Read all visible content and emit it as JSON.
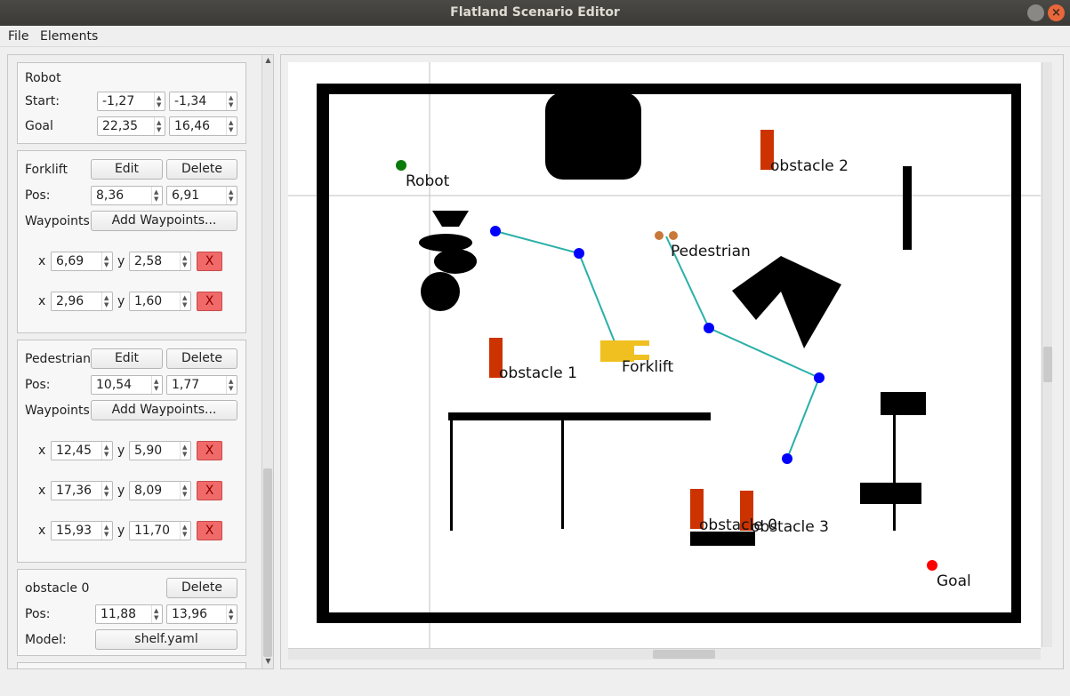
{
  "window": {
    "title": "Flatland Scenario Editor",
    "close_glyph": "×"
  },
  "menu": {
    "file": "File",
    "elements": "Elements"
  },
  "robot": {
    "title": "Robot",
    "start_label": "Start:",
    "start_x": "-1,27",
    "start_y": "-1,34",
    "goal_label": "Goal",
    "goal_x": "22,35",
    "goal_y": "16,46"
  },
  "forklift": {
    "title": "Forklift",
    "edit": "Edit",
    "delete": "Delete",
    "pos_label": "Pos:",
    "pos_x": "8,36",
    "pos_y": "6,91",
    "waypoints_label": "Waypoints:",
    "add_waypoints": "Add Waypoints...",
    "waypoints": [
      {
        "xl": "x",
        "x": "6,69",
        "yl": "y",
        "y": "2,58",
        "del": "X"
      },
      {
        "xl": "x",
        "x": "2,96",
        "yl": "y",
        "y": "1,60",
        "del": "X"
      }
    ]
  },
  "pedestrian": {
    "title": "Pedestrian",
    "edit": "Edit",
    "delete": "Delete",
    "pos_label": "Pos:",
    "pos_x": "10,54",
    "pos_y": "1,77",
    "waypoints_label": "Waypoints:",
    "add_waypoints": "Add Waypoints...",
    "waypoints": [
      {
        "xl": "x",
        "x": "12,45",
        "yl": "y",
        "y": "5,90",
        "del": "X"
      },
      {
        "xl": "x",
        "x": "17,36",
        "yl": "y",
        "y": "8,09",
        "del": "X"
      },
      {
        "xl": "x",
        "x": "15,93",
        "yl": "y",
        "y": "11,70",
        "del": "X"
      }
    ]
  },
  "obstacle0": {
    "title": "obstacle 0",
    "delete": "Delete",
    "pos_label": "Pos:",
    "pos_x": "11,88",
    "pos_y": "13,96",
    "model_label": "Model:",
    "model": "shelf.yaml"
  },
  "map_labels": {
    "robot": "Robot",
    "goal": "Goal",
    "pedestrian": "Pedestrian",
    "forklift": "Forklift",
    "obstacle0": "obstacle 0",
    "obstacle1": "obstacle 1",
    "obstacle2": "obstacle 2",
    "obstacle3": "obstacle 3"
  },
  "colors": {
    "robot": "#0a7a0a",
    "goal": "#ff0000",
    "waypoint": "#0000ff",
    "path": "#2ab0a8",
    "obstacle": "#cc3300",
    "forklift": "#f0c020",
    "pedestrian": "#c87838",
    "delete_button": "#f06a6a"
  }
}
